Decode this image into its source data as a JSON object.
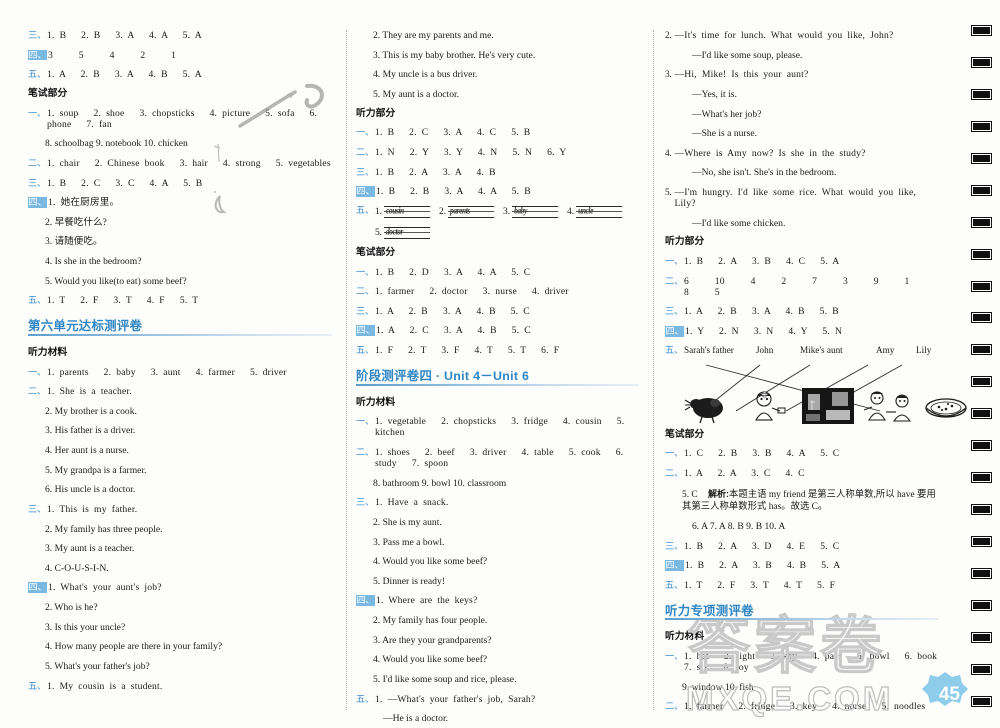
{
  "document": {
    "page_number": "45",
    "watermark_top": "答案卷",
    "watermark_bottom": "MXQE.COM"
  },
  "labels": {
    "listening_material": "听力材料",
    "listening_part": "听力部分",
    "written_part": "笔试部分",
    "num_1": "一、",
    "num_2": "二、",
    "num_3": "三、",
    "num_4": "四、",
    "num_5": "五、"
  },
  "column_left": {
    "top_answers": [
      {
        "num": "三、",
        "text": "1. B   2. B   3. A   4. A   5. A"
      },
      {
        "num": "四、",
        "text": "3   5   4   2   1",
        "boxed": true
      },
      {
        "num": "五、",
        "text": "1. A   2. B   3. A   4. B   5. A"
      }
    ],
    "written_heading": "笔试部分",
    "written_answers": [
      {
        "num": "一、",
        "text": "1. soup   2. shoe   3. chopsticks   4. picture   5. sofa   6. phone   7. fan"
      },
      {
        "num": "",
        "text": "8. schoolbag   9. notebook   10. chicken"
      },
      {
        "num": "二、",
        "text": "1. chair   2. Chinese book   3. hair   4. strong   5. vegetables"
      },
      {
        "num": "三、",
        "text": "1. B   2. C   3. C   4. A   5. B"
      }
    ],
    "translation_group": {
      "num": "四、",
      "items": [
        "1. 她在厨房里。",
        "2. 早餐吃什么?",
        "3. 请随便吃。",
        "4. Is she in the bedroom?",
        "5. Would you like(to eat) some beef?"
      ]
    },
    "tf_row": {
      "num": "五、",
      "text": "1. T   2. F   3. T   4. F   5. T"
    },
    "unit_title": "第六单元达标测评卷",
    "listening_heading": "听力材料",
    "listening_items": [
      {
        "num": "一、",
        "text": "1. parents   2. baby   3. aunt   4. farmer   5. driver"
      },
      {
        "num": "二、",
        "text": "1. She is a teacher."
      },
      {
        "num": "",
        "text": "2. My brother is a cook."
      },
      {
        "num": "",
        "text": "3. His father is a driver."
      },
      {
        "num": "",
        "text": "4. Her aunt is a nurse."
      },
      {
        "num": "",
        "text": "5. My grandpa is a farmer."
      },
      {
        "num": "",
        "text": "6. His uncle is a doctor."
      },
      {
        "num": "三、",
        "text": "1. This is my father."
      },
      {
        "num": "",
        "text": "2. My family has three people."
      },
      {
        "num": "",
        "text": "3. My aunt is a teacher."
      },
      {
        "num": "",
        "text": "4. C-O-U-S-I-N."
      },
      {
        "num": "四、",
        "text": "1. What's your aunt's job?",
        "boxed": true
      },
      {
        "num": "",
        "text": "2. Who is he?"
      },
      {
        "num": "",
        "text": "3. Is this your uncle?"
      },
      {
        "num": "",
        "text": "4. How many people are there in your family?"
      },
      {
        "num": "",
        "text": "5. What's your father's job?"
      },
      {
        "num": "五、",
        "text": "1. My cousin is a student."
      }
    ]
  },
  "column_mid": {
    "continued_items": [
      "2. They are my parents and me.",
      "3. This is my baby brother. He's very cute.",
      "4. My uncle is a bus driver.",
      "5. My aunt is a doctor."
    ],
    "listening_heading": "听力部分",
    "listening_answers": [
      {
        "num": "一、",
        "text": "1. B   2. C   3. A   4. C   5. B"
      },
      {
        "num": "二、",
        "text": "1. N   2. Y   3. Y   4. N   5. N   6. Y"
      },
      {
        "num": "三、",
        "text": "1. B   2. A   3. A   4. B"
      },
      {
        "num": "四、",
        "text": "1. B   2. B   3. A   4. A   5. B",
        "boxed": true
      }
    ],
    "handwriting_row": {
      "num": "五、",
      "words": [
        {
          "idx": "1.",
          "word": "cousin"
        },
        {
          "idx": "2.",
          "word": "parents"
        },
        {
          "idx": "3.",
          "word": "baby"
        },
        {
          "idx": "4.",
          "word": "uncle"
        },
        {
          "idx": "5.",
          "word": "doctor"
        }
      ]
    },
    "written_heading": "笔试部分",
    "written_answers": [
      {
        "num": "一、",
        "text": "1. B   2. D   3. A   4. A   5. C"
      },
      {
        "num": "二、",
        "text": "1. farmer   2. doctor   3. nurse   4. driver"
      },
      {
        "num": "三、",
        "text": "1. A   2. B   3. A   4. B   5. C"
      },
      {
        "num": "四、",
        "text": "1. A   2. C   3. A   4. B   5. C",
        "boxed": true
      },
      {
        "num": "五、",
        "text": "1. F   2. T   3. F   4. T   5. T   6. F"
      }
    ],
    "unit_title": "阶段测评卷四 · Unit 4－Unit 6",
    "listening_material_heading": "听力材料",
    "listening_material": [
      {
        "num": "一、",
        "text": "1. vegetable   2. chopsticks   3. fridge   4. cousin   5. kitchen"
      },
      {
        "num": "二、",
        "text": "1. shoes   2. beef   3. driver   4. table   5. cook   6. study   7. spoon"
      },
      {
        "num": "",
        "text": "8. bathroom   9. bowl   10. classroom"
      },
      {
        "num": "三、",
        "text": "1. Have a snack."
      },
      {
        "num": "",
        "text": "2. She is my aunt."
      },
      {
        "num": "",
        "text": "3. Pass me a bowl."
      },
      {
        "num": "",
        "text": "4. Would you like some beef?"
      },
      {
        "num": "",
        "text": "5. Dinner is ready!"
      },
      {
        "num": "四、",
        "text": "1. Where are the keys?",
        "boxed": true
      },
      {
        "num": "",
        "text": "2. My family has four people."
      },
      {
        "num": "",
        "text": "3. Are they your grandparents?"
      },
      {
        "num": "",
        "text": "4. Would you like some beef?"
      },
      {
        "num": "",
        "text": "5. I'd like some soup and rice, please."
      },
      {
        "num": "五、",
        "text": "1. —What's your father's job, Sarah?"
      },
      {
        "num": "",
        "text": "—He is a doctor.",
        "indent": "deep"
      }
    ]
  },
  "column_right": {
    "dialogues": [
      {
        "num": "2.",
        "lines": [
          "—It's time for lunch. What would you like, John?",
          "—I'd like some soup, please."
        ]
      },
      {
        "num": "3.",
        "lines": [
          "—Hi, Mike! Is this your aunt?",
          "—Yes, it is.",
          "—What's her job?",
          "—She is a nurse."
        ]
      },
      {
        "num": "4.",
        "lines": [
          "—Where is Amy now? Is she in the study?",
          "—No, she isn't. She's in the bedroom."
        ]
      },
      {
        "num": "5.",
        "lines": [
          "—I'm hungry. I'd like some rice. What would you like, Lily?",
          "—I'd like some chicken."
        ]
      }
    ],
    "listening_heading": "听力部分",
    "listening_answers": [
      {
        "num": "一、",
        "text": "1. B   2. A   3. B   4. C   5. A"
      },
      {
        "num": "二、",
        "text": "6   10   4   2   7   3   9   1   8   5"
      },
      {
        "num": "三、",
        "text": "1. A   2. B   3. A   4. B   5. B"
      },
      {
        "num": "四、",
        "text": "1. Y   2. N   3. N   4. Y   5. N",
        "boxed": true
      }
    ],
    "matching": {
      "num": "五、",
      "labels": [
        "Sarah's father",
        "John",
        "Mike's aunt",
        "Amy",
        "Lily"
      ],
      "pictures": [
        "chicken-icon",
        "nurse-icon",
        "bedroom-icon",
        "people-icon",
        "soup-bowl-icon"
      ]
    },
    "written_heading": "笔试部分",
    "written_answers": [
      {
        "num": "一、",
        "text": "1. C   2. B   3. B   4. A   5. C"
      },
      {
        "num": "二、",
        "text": "1. A   2. A   3. C   4. C"
      }
    ],
    "explanation": {
      "lead": "5. C",
      "tag": "解析:",
      "text": "本题主语 my friend 是第三人称单数,所以 have 要用其第三人称单数形式 has。故选 C。"
    },
    "written_answers_2": [
      {
        "num": "",
        "text": "6. A   7. A   8. B   9. B   10. A",
        "indent": true
      },
      {
        "num": "三、",
        "text": "1. B   2. A   3. D   4. E   5. C"
      },
      {
        "num": "四、",
        "text": "1. B   2. A   3. B   4. B   5. A",
        "boxed": true
      },
      {
        "num": "五、",
        "text": "1. T   2. F   3. T   4. T   5. F"
      }
    ],
    "unit_title": "听力专项测评卷",
    "listening_material_heading": "听力材料",
    "listening_material": [
      {
        "num": "一、",
        "text": "1. hat   2. light   3. key   4. pass   5. bowl   6. book   7. six   8. toy"
      },
      {
        "num": "",
        "text": "9. window   10. fish"
      },
      {
        "num": "二、",
        "text": "1. farmer   2. fridge   3. key   4. nurse   5. noodles"
      }
    ]
  },
  "colors": {
    "accent_blue": "#3f8fce",
    "heading_blue": "#2f86c4",
    "box_blue": "#79b8e0",
    "watermark_blue": "#9fd3ee"
  }
}
